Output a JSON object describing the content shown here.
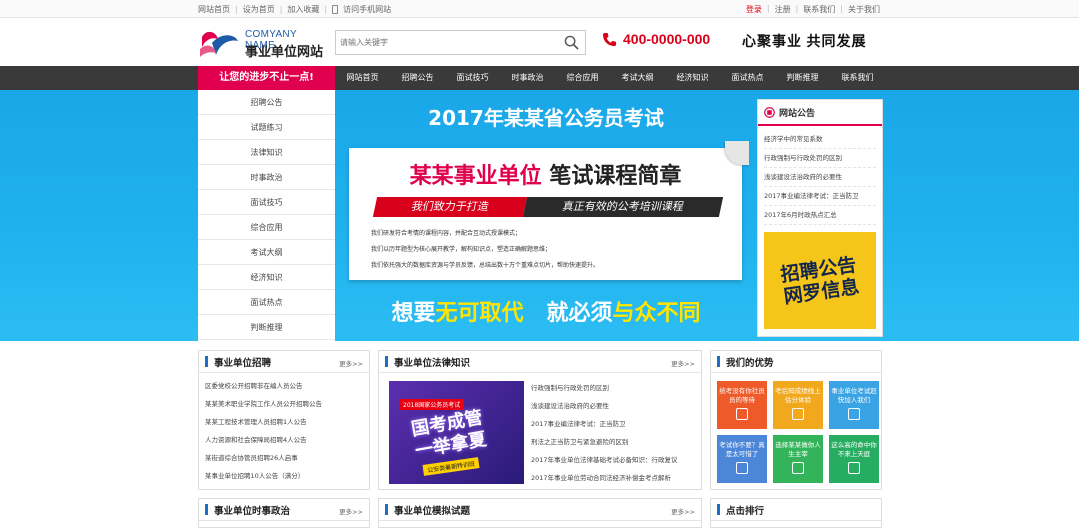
{
  "topbar": {
    "links": [
      "网站首页",
      "设为首页",
      "加入收藏",
      "访问手机网站"
    ],
    "login": "登录",
    "register": "注册",
    "contact": "联系我们",
    "about": "关于我们"
  },
  "header": {
    "logo_en": "COMYANY NAME",
    "logo_cn": "事业单位网站",
    "search_placeholder": "请输入关键字",
    "phone": "400-0000-000",
    "slogan": "心聚事业 共同发展"
  },
  "nav": {
    "promo": "让您的进步不止一点!",
    "items": [
      "网站首页",
      "招聘公告",
      "面试技巧",
      "时事政治",
      "综合应用",
      "考试大纲",
      "经济知识",
      "面试热点",
      "判断推理",
      "联系我们"
    ]
  },
  "sidemenu": [
    "招聘公告",
    "试题练习",
    "法律知识",
    "时事政治",
    "面试技巧",
    "综合应用",
    "考试大纲",
    "经济知识",
    "面试热点",
    "判断推理"
  ],
  "banner": {
    "title": "2017年某某省公务员考试",
    "card_pink": "某某事业单位",
    "card_dark": "笔试课程简章",
    "ribbon_left": "我们致力于打造",
    "ribbon_right": "真正有效的公考培训课程",
    "lines": [
      "我们研发符合考情的课程内容，并配合互动式授课模式；",
      "我们以历年题型为核心展开教学，解构知识点，塑造正确解题思维；",
      "我们依托强大的数据库资源与学员反馈，总结出数十万个重难点切片，帮助快速提升。"
    ],
    "bottom_white1": "想要",
    "bottom_yellow1": "无可取代",
    "bottom_white2": "就必须",
    "bottom_yellow2": "与众不同"
  },
  "notice": {
    "title": "网站公告",
    "items": [
      "经济学中的常见系数",
      "行政强制与行政处罚的区别",
      "浅谈建设法治政府的必要性",
      "2017事业编法律考试：正当防卫",
      "2017年6月时政热点汇总"
    ],
    "recruit_text1": "招聘公告",
    "recruit_text2": "网罗信息"
  },
  "recruit_panel": {
    "title": "事业单位招聘",
    "more": "更多>>",
    "items": [
      "区委党校公开招聘非在编人员公告",
      "某某美术职业学院工作人员公开招聘公告",
      "某某工程技术管理人员招聘1人公告",
      "人力资源和社会保障局招聘4人公告",
      "某街道综合协管员招聘26人启事",
      "某事业单位招聘10人公告（满分）"
    ]
  },
  "law_panel": {
    "title": "事业单位法律知识",
    "more": "更多>>",
    "img_label": "2018国家公务员考试",
    "img_big1": "国考成管",
    "img_big2": "一举拿夏",
    "img_bottom": "公安类暑期特训班",
    "items": [
      "行政强制与行政处罚的区别",
      "浅谈建设法治政府的必要性",
      "2017事业编法律考试：正当防卫",
      "刑法之正当防卫与紧急避险的区别",
      "2017年事业单位法律基础考试必备知识：行政复议",
      "2017年事业单位劳动合同法经济补偿金考点解析"
    ]
  },
  "advantage_panel": {
    "title": "我们的优势",
    "tiles": [
      {
        "text": "统考没有你社员员的等待",
        "color": "#ef5a2a"
      },
      {
        "text": "考后知成绩线上估分体验",
        "color": "#f2a81d"
      },
      {
        "text": "事业单位考试赶快加入我们",
        "color": "#3aa3e3"
      },
      {
        "text": "考试你不要？真是太可惜了",
        "color": "#4b86d9"
      },
      {
        "text": "选择某某做你人生主宰",
        "color": "#34b45a"
      },
      {
        "text": "这么高的命中你不来上天庭",
        "color": "#27ad62"
      }
    ]
  },
  "bottom_panels": {
    "politics": "事业单位时事政治",
    "mock": "事业单位模拟试题",
    "rank": "点击排行",
    "more": "更多>>"
  },
  "colors": {
    "accent": "#e0004d",
    "nav": "#3a3a3a",
    "banner": "#1fb1ee",
    "phone": "#d9001b"
  }
}
